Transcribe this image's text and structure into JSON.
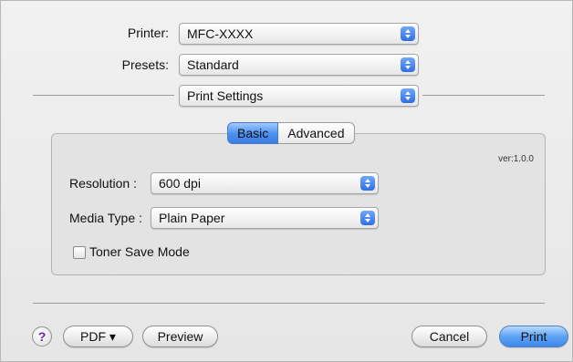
{
  "printer": {
    "label": "Printer:",
    "value": "MFC-XXXX"
  },
  "presets": {
    "label": "Presets:",
    "value": "Standard"
  },
  "panel_menu": {
    "value": "Print Settings"
  },
  "tabs": [
    {
      "label": "Basic",
      "selected": true
    },
    {
      "label": "Advanced",
      "selected": false
    }
  ],
  "version": "ver:1.0.0",
  "resolution": {
    "label": "Resolution :",
    "value": "600 dpi"
  },
  "media_type": {
    "label": "Media Type :",
    "value": "Plain Paper"
  },
  "toner_save": {
    "label": "Toner Save Mode",
    "checked": false
  },
  "buttons": {
    "help": "?",
    "pdf": "PDF ▾",
    "preview": "Preview",
    "cancel": "Cancel",
    "print": "Print"
  },
  "colors": {
    "accent": "#3f88ea",
    "window_bg": "#ececec",
    "help_glyph": "#6a1fb5"
  }
}
